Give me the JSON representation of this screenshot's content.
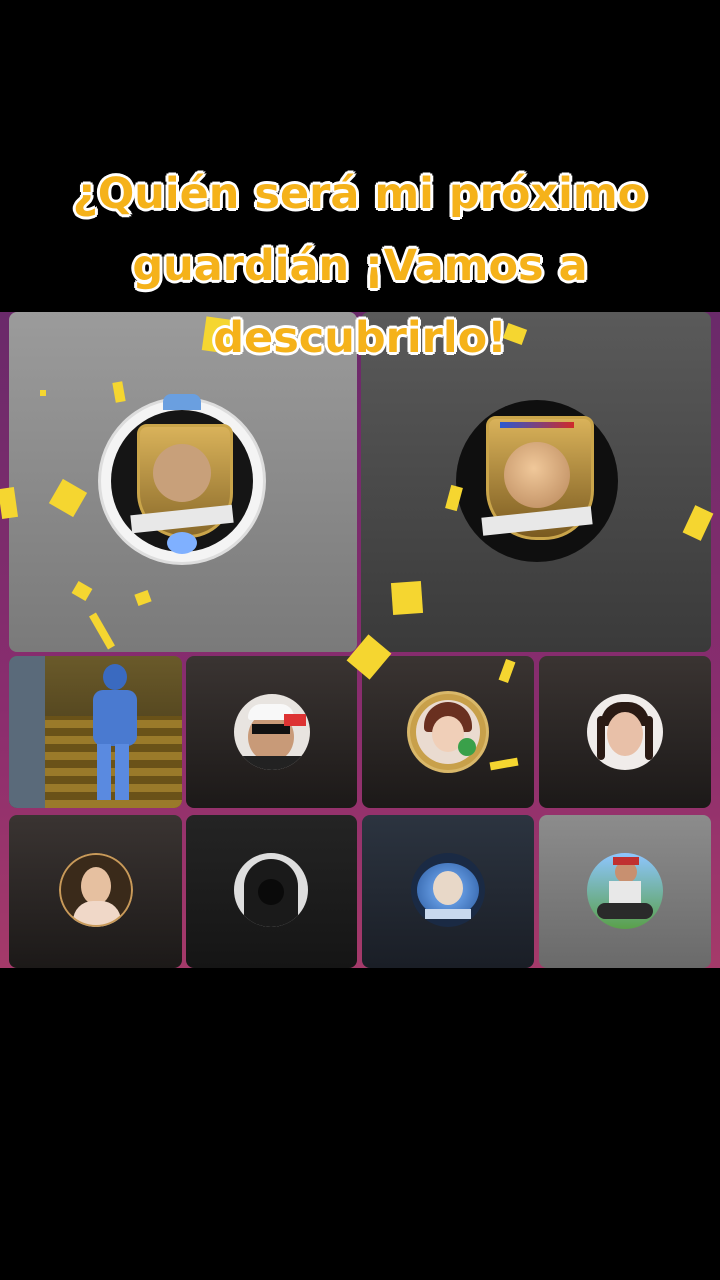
{
  "caption": {
    "line1": "¿Quién será mi próximo",
    "line2": "guardián ¡Vamos a",
    "line3": "descubrirlo!"
  },
  "colors": {
    "caption_text": "#f5b21a",
    "caption_outline": "#ffffff",
    "stage_background": "#8a2d6e",
    "confetti": "#f5d630"
  },
  "grid": {
    "top_row": [
      {
        "seat": "host",
        "avatar": "crest-badge-avatar-man"
      },
      {
        "seat": "co-host",
        "avatar": "crest-badge-avatar-woman"
      }
    ],
    "middle_row": [
      {
        "seat": "guest-1",
        "avatar": "live-video-dancer"
      },
      {
        "seat": "guest-2",
        "avatar": "avatar-man-sunglasses"
      },
      {
        "seat": "guest-3",
        "avatar": "avatar-woman-gold-frame"
      },
      {
        "seat": "guest-4",
        "avatar": "avatar-woman-braids"
      }
    ],
    "bottom_row": [
      {
        "seat": "guest-5",
        "avatar": "avatar-woman-dark-hair"
      },
      {
        "seat": "guest-6",
        "avatar": "avatar-hooded-figure"
      },
      {
        "seat": "guest-7",
        "avatar": "avatar-blue-crest"
      },
      {
        "seat": "guest-8",
        "avatar": "avatar-man-motorcycle"
      }
    ]
  }
}
